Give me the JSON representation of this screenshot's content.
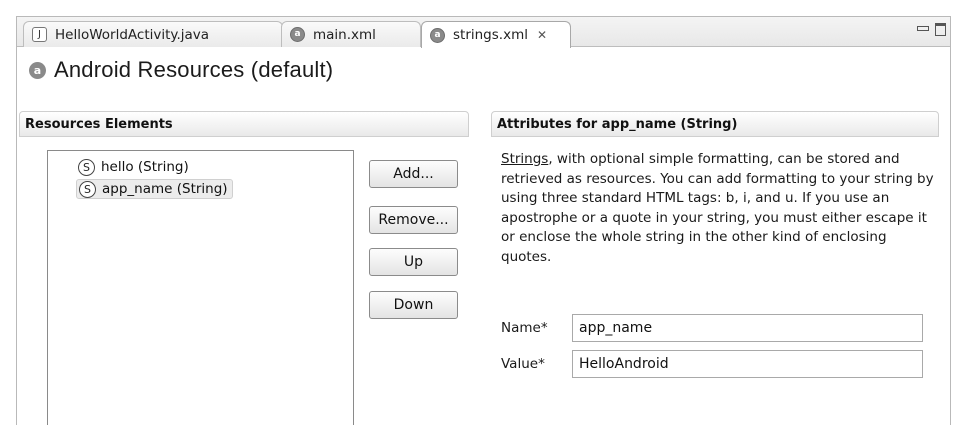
{
  "tabs": [
    {
      "label": "HelloWorldActivity.java",
      "icon": "java-file-icon",
      "glyph": "J"
    },
    {
      "label": "main.xml",
      "icon": "android-xml-icon",
      "glyph": "a"
    },
    {
      "label": "strings.xml",
      "icon": "android-xml-icon",
      "glyph": "a",
      "close": "✕",
      "active": true
    }
  ],
  "title": {
    "text": "Android Resources (default)",
    "glyph": "a"
  },
  "left_panel": {
    "header": "Resources Elements",
    "items": [
      {
        "label": "hello (String)",
        "glyph": "S"
      },
      {
        "label": "app_name (String)",
        "glyph": "S",
        "selected": true
      }
    ],
    "buttons": {
      "add": "Add...",
      "remove": "Remove...",
      "up": "Up",
      "down": "Down"
    }
  },
  "right_panel": {
    "header": "Attributes for app_name (String)",
    "desc_link": "Strings",
    "desc_rest": ", with optional simple formatting, can be stored and retrieved as resources. You can add formatting to your string by using three standard HTML tags: b, i, and u. If you use an apostrophe or a quote in your string, you must either escape it or enclose the whole string in the other kind of enclosing quotes.",
    "name_label": "Name*",
    "name_value": "app_name",
    "value_label": "Value*",
    "value_value": "HelloAndroid"
  }
}
